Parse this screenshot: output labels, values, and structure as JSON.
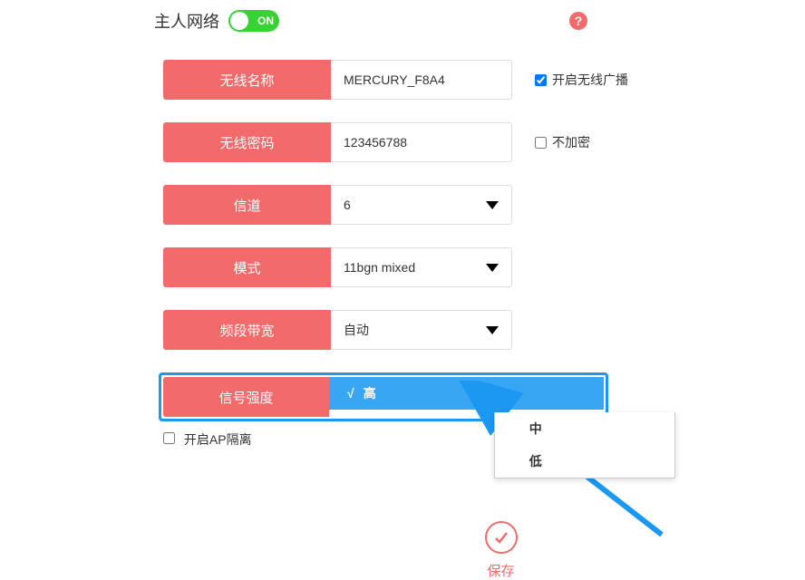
{
  "header": {
    "title": "主人网络",
    "toggle_label": "ON"
  },
  "rows": {
    "ssid": {
      "label": "无线名称",
      "value": "MERCURY_F8A4"
    },
    "password": {
      "label": "无线密码",
      "value": "123456788"
    },
    "channel": {
      "label": "信道",
      "value": "6"
    },
    "mode": {
      "label": "模式",
      "value": "11bgn mixed"
    },
    "bandwidth": {
      "label": "频段带宽",
      "value": "自动"
    },
    "signal": {
      "label": "信号强度",
      "value": "高"
    }
  },
  "side_checks": {
    "broadcast": "开启无线广播",
    "unencrypted": "不加密"
  },
  "signal_options": {
    "high": "高",
    "mid": "中",
    "low": "低"
  },
  "ap_isolation": "开启AP隔离",
  "save_label": "保存"
}
